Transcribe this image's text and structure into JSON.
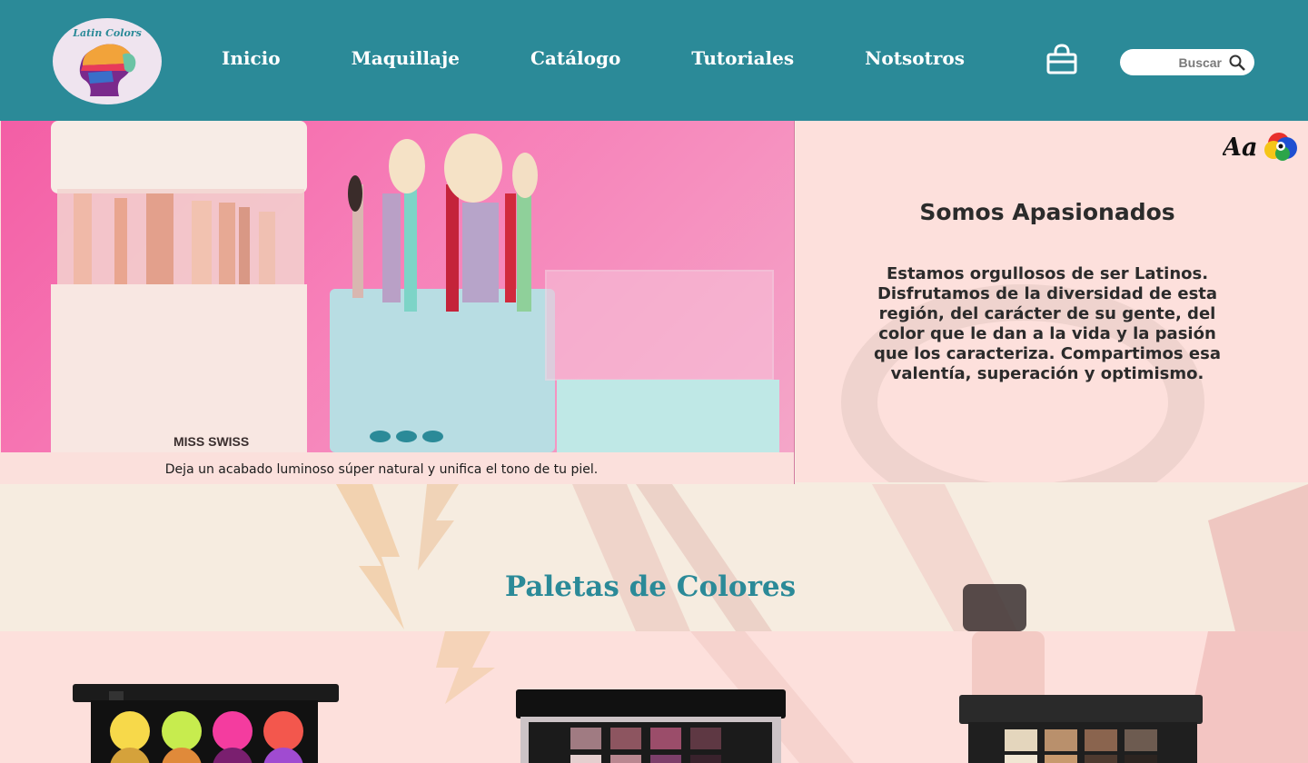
{
  "header": {
    "logo_text": "Latin Colors",
    "nav": [
      "Inicio",
      "Maquillaje",
      "Catálogo",
      "Tutoriales",
      "Notsotros"
    ],
    "search": {
      "placeholder": "Buscar"
    },
    "background": "#2b8a98"
  },
  "hero": {
    "caption": "Deja un acabado luminoso súper natural y unifica el tono de tu piel.",
    "product_brand": "MISS SWISS"
  },
  "about": {
    "font_icon_label": "Aa",
    "title": "Somos Apasionados",
    "text": "Estamos orgullosos de ser Latinos. Disfrutamos de la diversidad de esta región, del carácter de su gente, del color que le dan a la vida y la pasión que los caracteriza. Compartimos esa valentía, superación y optimismo."
  },
  "palettes": {
    "title": "Paletas de Colores"
  },
  "colors": {
    "accent": "#2b8a98",
    "pink_bg": "#fde0dc",
    "cream_bg": "#f6ece0"
  }
}
